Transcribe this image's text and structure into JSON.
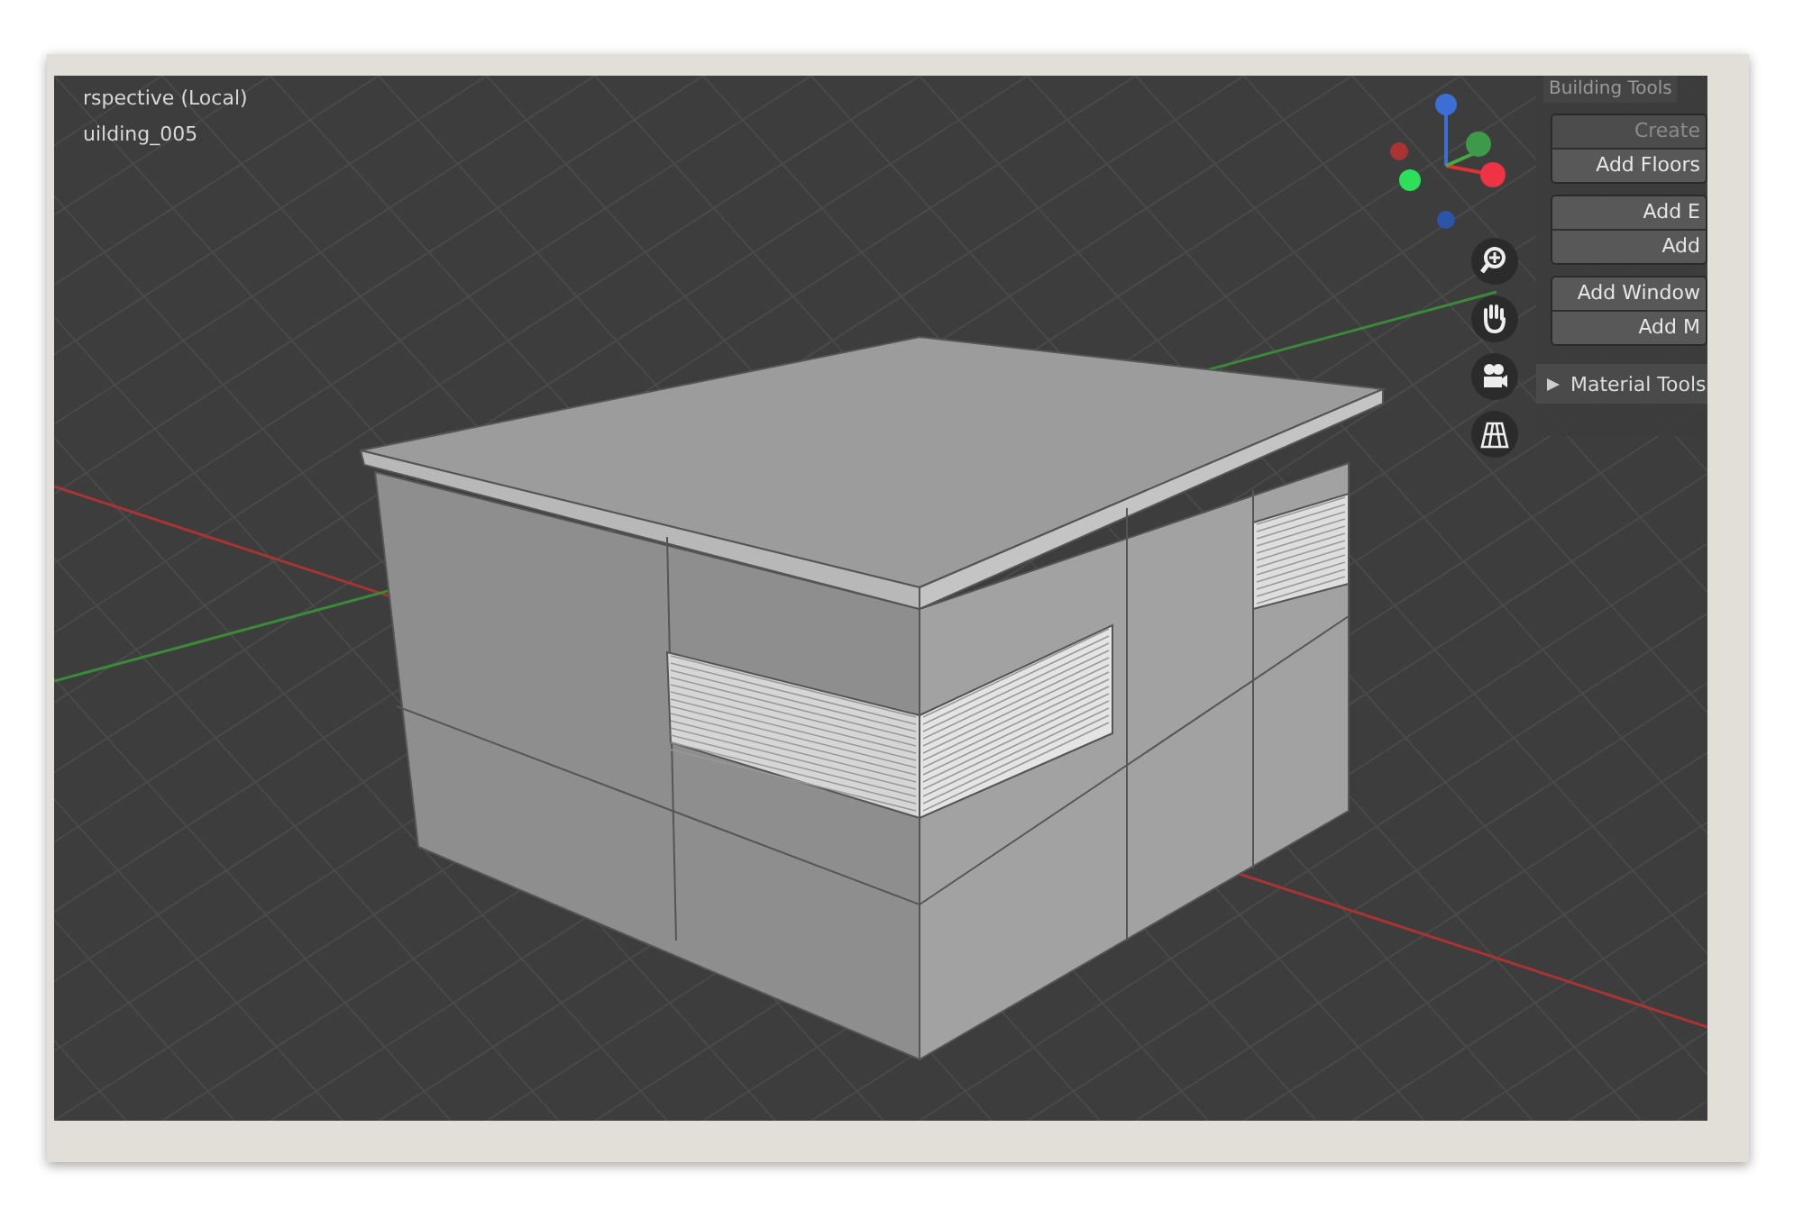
{
  "viewport": {
    "view_label": "rspective (Local)",
    "object_name": "uilding_005"
  },
  "panel": {
    "title": "Building Tools",
    "groups": [
      [
        {
          "label": "Create",
          "disabled": true
        },
        {
          "label": "Add Floors",
          "disabled": false
        }
      ],
      [
        {
          "label": "Add E",
          "disabled": false
        },
        {
          "label": "Add",
          "disabled": false
        }
      ],
      [
        {
          "label": "Add Window",
          "disabled": false
        },
        {
          "label": "Add M",
          "disabled": false
        }
      ]
    ],
    "section": {
      "label": "Material Tools",
      "expanded": false
    }
  }
}
